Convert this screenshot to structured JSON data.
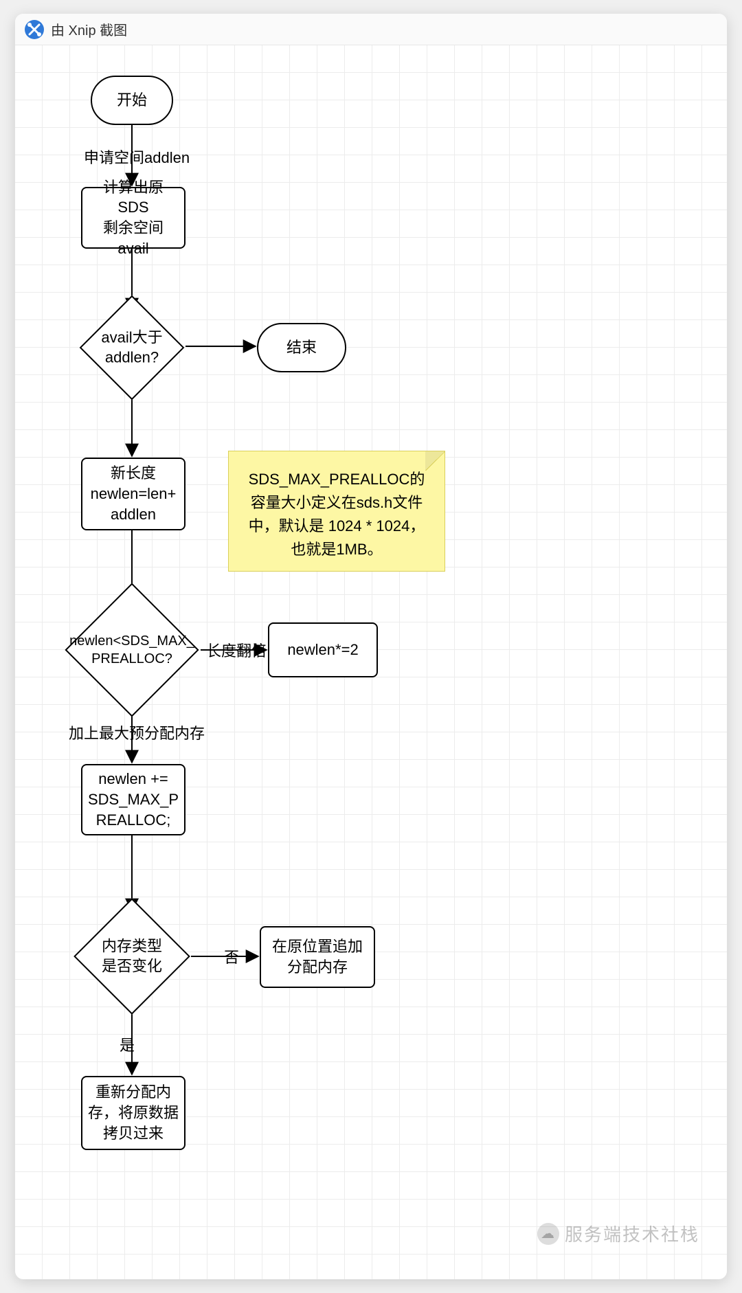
{
  "app": {
    "title": "由 Xnip 截图"
  },
  "nodes": {
    "start": "开始",
    "calc_avail": "计算出原SDS\n剩余空间avail",
    "end": "结束",
    "newlen_assign": "新长度\nnewlen=len+\naddlen",
    "newlen_double": "newlen*=2",
    "newlen_add_prealloc": "newlen +=\nSDS_MAX_P\nREALLOC;",
    "append_inplace": "在原位置追加\n分配内存",
    "realloc_copy": "重新分配内\n存，将原数据\n拷贝过来"
  },
  "decisions": {
    "avail_gt_addlen": "avail大于\naddlen?",
    "newlen_lt_max": "newlen<SDS_MAX_\nPREALLOC?",
    "memtype_changed": "内存类型\n是否变化"
  },
  "edges": {
    "apply_addlen": "申请空间addlen",
    "length_double": "长度翻倍",
    "add_max_prealloc": "加上最大预分配内存",
    "no": "否",
    "yes": "是"
  },
  "note": "SDS_MAX_PREALLOC的容量大小定义在sds.h文件中，默认是 1024 * 1024，也就是1MB。",
  "watermark": "服务端技术社栈"
}
